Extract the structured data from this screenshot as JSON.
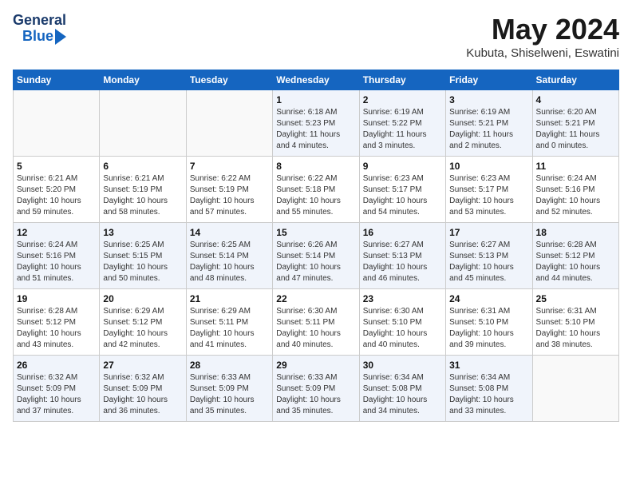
{
  "header": {
    "logo_line1": "General",
    "logo_line2": "Blue",
    "month": "May 2024",
    "location": "Kubuta, Shiselweni, Eswatini"
  },
  "weekdays": [
    "Sunday",
    "Monday",
    "Tuesday",
    "Wednesday",
    "Thursday",
    "Friday",
    "Saturday"
  ],
  "weeks": [
    [
      {
        "day": "",
        "info": ""
      },
      {
        "day": "",
        "info": ""
      },
      {
        "day": "",
        "info": ""
      },
      {
        "day": "1",
        "info": "Sunrise: 6:18 AM\nSunset: 5:23 PM\nDaylight: 11 hours\nand 4 minutes."
      },
      {
        "day": "2",
        "info": "Sunrise: 6:19 AM\nSunset: 5:22 PM\nDaylight: 11 hours\nand 3 minutes."
      },
      {
        "day": "3",
        "info": "Sunrise: 6:19 AM\nSunset: 5:21 PM\nDaylight: 11 hours\nand 2 minutes."
      },
      {
        "day": "4",
        "info": "Sunrise: 6:20 AM\nSunset: 5:21 PM\nDaylight: 11 hours\nand 0 minutes."
      }
    ],
    [
      {
        "day": "5",
        "info": "Sunrise: 6:21 AM\nSunset: 5:20 PM\nDaylight: 10 hours\nand 59 minutes."
      },
      {
        "day": "6",
        "info": "Sunrise: 6:21 AM\nSunset: 5:19 PM\nDaylight: 10 hours\nand 58 minutes."
      },
      {
        "day": "7",
        "info": "Sunrise: 6:22 AM\nSunset: 5:19 PM\nDaylight: 10 hours\nand 57 minutes."
      },
      {
        "day": "8",
        "info": "Sunrise: 6:22 AM\nSunset: 5:18 PM\nDaylight: 10 hours\nand 55 minutes."
      },
      {
        "day": "9",
        "info": "Sunrise: 6:23 AM\nSunset: 5:17 PM\nDaylight: 10 hours\nand 54 minutes."
      },
      {
        "day": "10",
        "info": "Sunrise: 6:23 AM\nSunset: 5:17 PM\nDaylight: 10 hours\nand 53 minutes."
      },
      {
        "day": "11",
        "info": "Sunrise: 6:24 AM\nSunset: 5:16 PM\nDaylight: 10 hours\nand 52 minutes."
      }
    ],
    [
      {
        "day": "12",
        "info": "Sunrise: 6:24 AM\nSunset: 5:16 PM\nDaylight: 10 hours\nand 51 minutes."
      },
      {
        "day": "13",
        "info": "Sunrise: 6:25 AM\nSunset: 5:15 PM\nDaylight: 10 hours\nand 50 minutes."
      },
      {
        "day": "14",
        "info": "Sunrise: 6:25 AM\nSunset: 5:14 PM\nDaylight: 10 hours\nand 48 minutes."
      },
      {
        "day": "15",
        "info": "Sunrise: 6:26 AM\nSunset: 5:14 PM\nDaylight: 10 hours\nand 47 minutes."
      },
      {
        "day": "16",
        "info": "Sunrise: 6:27 AM\nSunset: 5:13 PM\nDaylight: 10 hours\nand 46 minutes."
      },
      {
        "day": "17",
        "info": "Sunrise: 6:27 AM\nSunset: 5:13 PM\nDaylight: 10 hours\nand 45 minutes."
      },
      {
        "day": "18",
        "info": "Sunrise: 6:28 AM\nSunset: 5:12 PM\nDaylight: 10 hours\nand 44 minutes."
      }
    ],
    [
      {
        "day": "19",
        "info": "Sunrise: 6:28 AM\nSunset: 5:12 PM\nDaylight: 10 hours\nand 43 minutes."
      },
      {
        "day": "20",
        "info": "Sunrise: 6:29 AM\nSunset: 5:12 PM\nDaylight: 10 hours\nand 42 minutes."
      },
      {
        "day": "21",
        "info": "Sunrise: 6:29 AM\nSunset: 5:11 PM\nDaylight: 10 hours\nand 41 minutes."
      },
      {
        "day": "22",
        "info": "Sunrise: 6:30 AM\nSunset: 5:11 PM\nDaylight: 10 hours\nand 40 minutes."
      },
      {
        "day": "23",
        "info": "Sunrise: 6:30 AM\nSunset: 5:10 PM\nDaylight: 10 hours\nand 40 minutes."
      },
      {
        "day": "24",
        "info": "Sunrise: 6:31 AM\nSunset: 5:10 PM\nDaylight: 10 hours\nand 39 minutes."
      },
      {
        "day": "25",
        "info": "Sunrise: 6:31 AM\nSunset: 5:10 PM\nDaylight: 10 hours\nand 38 minutes."
      }
    ],
    [
      {
        "day": "26",
        "info": "Sunrise: 6:32 AM\nSunset: 5:09 PM\nDaylight: 10 hours\nand 37 minutes."
      },
      {
        "day": "27",
        "info": "Sunrise: 6:32 AM\nSunset: 5:09 PM\nDaylight: 10 hours\nand 36 minutes."
      },
      {
        "day": "28",
        "info": "Sunrise: 6:33 AM\nSunset: 5:09 PM\nDaylight: 10 hours\nand 35 minutes."
      },
      {
        "day": "29",
        "info": "Sunrise: 6:33 AM\nSunset: 5:09 PM\nDaylight: 10 hours\nand 35 minutes."
      },
      {
        "day": "30",
        "info": "Sunrise: 6:34 AM\nSunset: 5:08 PM\nDaylight: 10 hours\nand 34 minutes."
      },
      {
        "day": "31",
        "info": "Sunrise: 6:34 AM\nSunset: 5:08 PM\nDaylight: 10 hours\nand 33 minutes."
      },
      {
        "day": "",
        "info": ""
      }
    ]
  ]
}
